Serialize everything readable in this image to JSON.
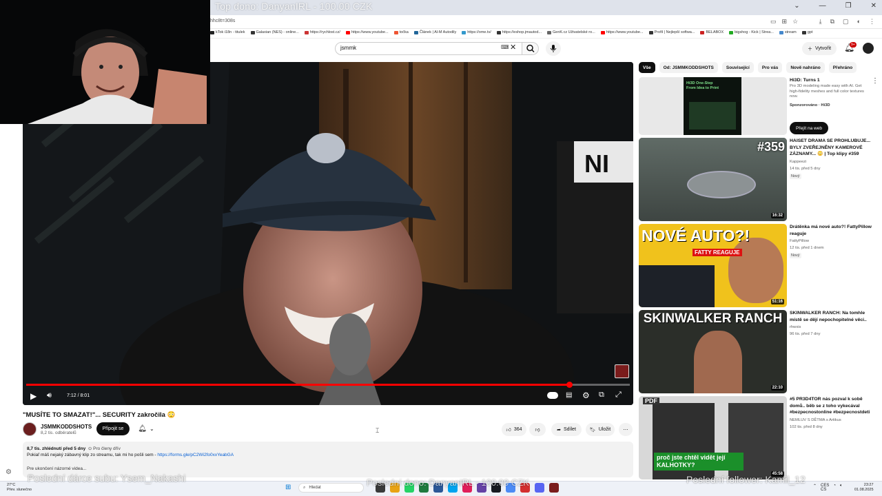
{
  "stream": {
    "top_donation": "Top dono: DanyanIRL - 100.00 CZK",
    "last_sub_donor": "Poslední dárce subu: Ysem_Nakashi",
    "last_dono": "Poslední dono: DanyanIRL - 100.00 CZK",
    "last_follower": "Poslední follower: Kamil_12"
  },
  "browser": {
    "url_fragment": "hhc8t=308s",
    "bookmarks": [
      {
        "label": "kTok i18n - titulek",
        "color": "#222"
      },
      {
        "label": "Galaxian (NES) - online...",
        "color": "#333"
      },
      {
        "label": "https://rychlost.cz/",
        "color": "#c33"
      },
      {
        "label": "https://www.youtube...",
        "color": "#f00"
      },
      {
        "label": "točka",
        "color": "#e53"
      },
      {
        "label": "Článek | Al-M Autodily",
        "color": "#269"
      },
      {
        "label": "https://ome.tv/",
        "color": "#39c"
      },
      {
        "label": "https://eshop.jmautod...",
        "color": "#333"
      },
      {
        "label": "GenK.cz Uživatelské ro...",
        "color": "#666"
      },
      {
        "label": "https://www.youtube...",
        "color": "#f00"
      },
      {
        "label": "Profil | Nejlepší softwa...",
        "color": "#333"
      },
      {
        "label": "BELABOX",
        "color": "#c22"
      },
      {
        "label": "bigshog - Kick | Strea...",
        "color": "#2a2"
      },
      {
        "label": "stream",
        "color": "#48c"
      },
      {
        "label": "gpt",
        "color": "#333"
      }
    ]
  },
  "header": {
    "search_value": "jsmmk",
    "create_label": "Vytvořit",
    "notif_count": "9+"
  },
  "player": {
    "time": "7:12 / 8:01",
    "progress": 0.899
  },
  "video": {
    "title": "\"MUSÍTE TO SMAZAT!\"... SECURITY zakročila 😳",
    "channel": "JSMMKODDSHOTS",
    "subs": "8,2 tis. odběratelů",
    "join": "Připojit se",
    "likes": "364",
    "share": "Sdílet",
    "save": "Uložit",
    "views_date": "8,7 tis. zhlédnutí  před 5 dny",
    "members": "Pro členy dřív",
    "desc_line1": "Pokiaľ máš nejaký zábavný klip zo streamu, tak mi ho pošli sem - ",
    "desc_link": "https://forms.gle/pC2Wi2fo0xxYeabGA",
    "desc_more": "Pre ukončení názorné videa..."
  },
  "chips": [
    "Vše",
    "Od: JSMMKODDSHOTS",
    "Související",
    "Pro vás",
    "Nově nahráno",
    "Přehráno"
  ],
  "sidebar": [
    {
      "title": "Hi3D:  Turns 1",
      "line2": "Pro 3D modeling made easy with AI. Get high-fidelity meshes and full color textures now.",
      "sponsored": "Sponzorováno · Hi3D",
      "cta": "Přejít na web",
      "thumb_text": "Hi3D One-Step From Idea to Print"
    },
    {
      "title": "HAISET DRAMA SE PROHLUBUJE... BYLY ZVEŘEJNĚNY KAMEROVÉ ZÁZNAMY... 😳 | Top klipy #359",
      "channel": "Kappeezi",
      "meta": "14 tis.  před 5 dny",
      "badge": "Nový",
      "duration": "16:32",
      "thumb_text": "#359"
    },
    {
      "title": "Drátěnka má nové auto?! FattyPillow reaguje",
      "channel": "FattyPillow",
      "meta": "12 tis.  před 1 dnem",
      "badge": "Nový",
      "duration": "51:16",
      "thumb_text": "NOVÉ AUTO?!",
      "thumb_sub": "FATTY REAGUJE"
    },
    {
      "title": "SKINWALKER RANCH: Na tomhle místě se dějí nepochopitelné věci..",
      "channel": "rhwxis",
      "meta": "96 tis.  před 7 dny",
      "duration": "22:10",
      "thumb_text": "SKINWALKER RANCH"
    },
    {
      "title": "#5 PR3D4TOR nás pozval k sobě domů.. běb se z toho vykecával #bezpecnostonline #bezpecnostdeti",
      "channel": "NEMLUV S DĚTMA s Artikus",
      "meta": "102 tis.  před 8 dny",
      "duration": "45:58",
      "thumb_text": "proč jste chtěl vidět její KALHOTKY?",
      "thumb_tag": "PDF"
    }
  ],
  "taskbar": {
    "weather_temp": "27°C",
    "weather_desc": "Pŕev. slunečno",
    "search_placeholder": "Hledat",
    "lang": "CES",
    "lang2": "CS",
    "time": "23:27",
    "date": "01.08.2025"
  },
  "colors": {
    "accent_red": "#ff0000",
    "chip_active": "#0f0f0f",
    "link_blue": "#065fd4"
  }
}
